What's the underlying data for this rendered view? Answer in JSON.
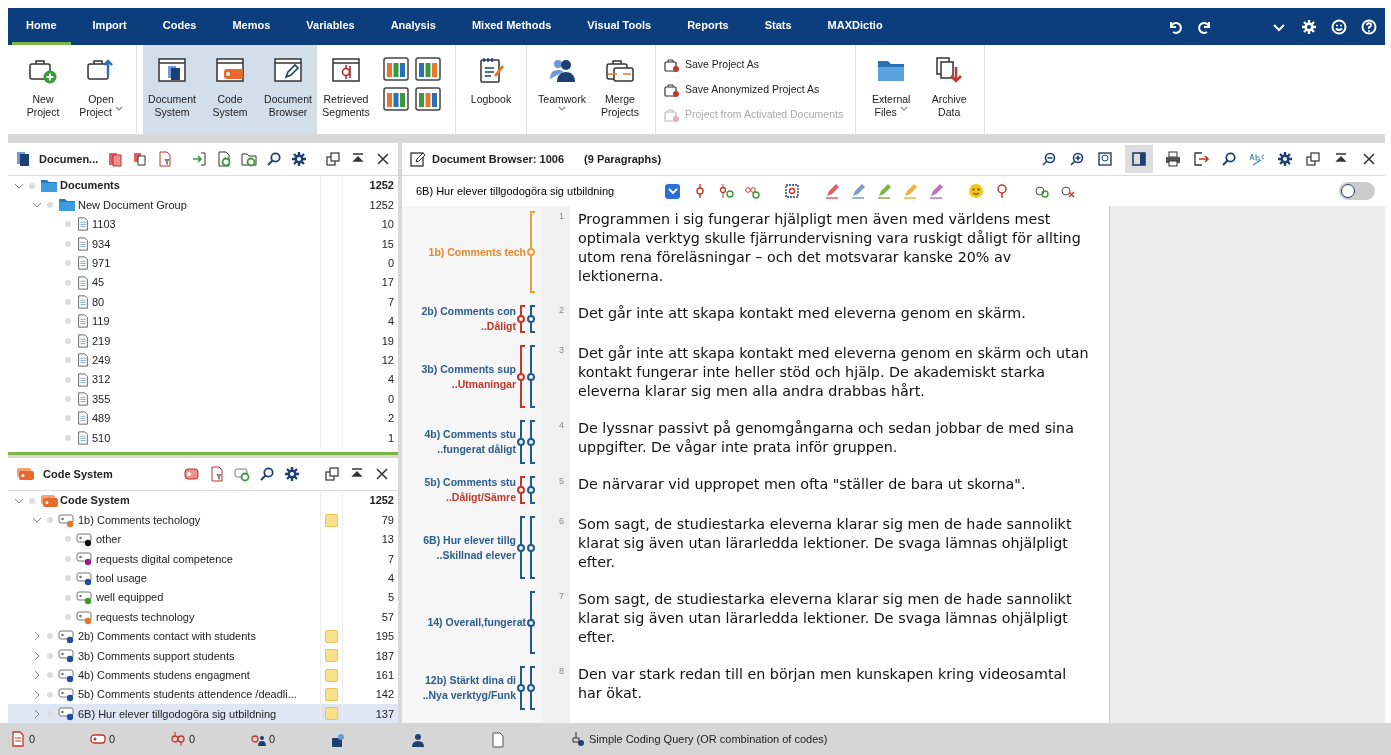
{
  "menu": {
    "tabs": [
      {
        "label": "Home",
        "selected": true
      },
      {
        "label": "Import",
        "selected": false
      },
      {
        "label": "Codes",
        "selected": false
      },
      {
        "label": "Memos",
        "selected": false
      },
      {
        "label": "Variables",
        "selected": false
      },
      {
        "label": "Analysis",
        "selected": false
      },
      {
        "label": "Mixed Methods",
        "selected": false
      },
      {
        "label": "Visual Tools",
        "selected": false
      },
      {
        "label": "Reports",
        "selected": false
      },
      {
        "label": "Stats",
        "selected": false
      },
      {
        "label": "MAXDictio",
        "selected": false
      }
    ]
  },
  "ribbon": {
    "groups": [
      {
        "buttons": [
          {
            "label": "New Project",
            "on": false,
            "dropdown": false
          },
          {
            "label": "Open Project",
            "on": false,
            "dropdown": true
          }
        ]
      },
      {
        "buttons": [
          {
            "label": "Document System",
            "on": true,
            "dropdown": false
          },
          {
            "label": "Code System",
            "on": true,
            "dropdown": false
          },
          {
            "label": "Document Browser",
            "on": true,
            "dropdown": false
          },
          {
            "label": "Retrieved Segments",
            "on": false,
            "dropdown": false
          }
        ]
      },
      {
        "buttons": [
          {
            "label": "Logbook",
            "on": false,
            "dropdown": false
          }
        ]
      },
      {
        "buttons": [
          {
            "label": "Teamwork",
            "on": false,
            "dropdown": true
          },
          {
            "label": "Merge Projects",
            "on": false,
            "dropdown": false
          }
        ]
      }
    ],
    "save_items": [
      {
        "label": "Save Project As",
        "disabled": false
      },
      {
        "label": "Save Anonymized Project As",
        "disabled": false
      },
      {
        "label": "Project from Activated Documents",
        "disabled": true
      }
    ],
    "file_buttons": [
      {
        "label": "External Files",
        "on": false,
        "dropdown": true
      },
      {
        "label": "Archive Data",
        "on": false,
        "dropdown": false
      }
    ]
  },
  "document_system": {
    "title": "Documen...",
    "tree": [
      {
        "label": "Documents",
        "count": "1252",
        "kind": "root",
        "expanded": true,
        "selected": false,
        "children": [
          {
            "label": "New Document Group",
            "count": "1252",
            "kind": "group",
            "expanded": true,
            "selected": false,
            "children": [
              {
                "label": "1103",
                "count": "10",
                "kind": "document",
                "selected": false
              },
              {
                "label": "934",
                "count": "15",
                "kind": "document",
                "selected": false
              },
              {
                "label": "971",
                "count": "0",
                "kind": "document",
                "selected": false
              },
              {
                "label": "45",
                "count": "17",
                "kind": "document",
                "selected": false
              },
              {
                "label": "80",
                "count": "7",
                "kind": "document",
                "selected": false
              },
              {
                "label": "119",
                "count": "4",
                "kind": "document",
                "selected": false
              },
              {
                "label": "219",
                "count": "19",
                "kind": "document",
                "selected": false
              },
              {
                "label": "249",
                "count": "12",
                "kind": "document",
                "selected": false
              },
              {
                "label": "312",
                "count": "4",
                "kind": "document",
                "selected": false
              },
              {
                "label": "355",
                "count": "0",
                "kind": "document",
                "selected": false
              },
              {
                "label": "489",
                "count": "2",
                "kind": "document",
                "selected": false
              },
              {
                "label": "510",
                "count": "1",
                "kind": "document",
                "selected": false
              }
            ]
          }
        ]
      }
    ]
  },
  "code_system": {
    "title": "Code System",
    "tree": [
      {
        "label": "Code System",
        "count": "1252",
        "kind": "root",
        "expanded": true,
        "selected": false,
        "children": [
          {
            "label": "1b) Comments  techology",
            "count": "79",
            "kind": "code",
            "color": "#e8772a",
            "memo": true,
            "expanded": true,
            "selected": false,
            "children": [
              {
                "label": "other",
                "count": "13",
                "kind": "code",
                "color": "#111111",
                "memo": false,
                "selected": false
              },
              {
                "label": "requests digital competence",
                "count": "7",
                "kind": "code",
                "color": "#9b1f8a",
                "memo": false,
                "selected": false
              },
              {
                "label": "tool usage",
                "count": "4",
                "kind": "code",
                "color": "#1f4f9a",
                "memo": false,
                "selected": false
              },
              {
                "label": "well equipped",
                "count": "5",
                "kind": "code",
                "color": "#3d9a2a",
                "memo": false,
                "selected": false
              },
              {
                "label": "requests technology",
                "count": "57",
                "kind": "code",
                "color": "#e8772a",
                "memo": false,
                "selected": false
              }
            ]
          },
          {
            "label": "2b) Comments contact with students",
            "count": "195",
            "kind": "code",
            "color": "#1f4f9a",
            "memo": true,
            "expanded": false,
            "selected": false
          },
          {
            "label": "3b) Comments support students",
            "count": "187",
            "kind": "code",
            "color": "#1f4f9a",
            "memo": true,
            "expanded": false,
            "selected": false
          },
          {
            "label": "4b) Comments studens engagment",
            "count": "161",
            "kind": "code",
            "color": "#1f4f9a",
            "memo": true,
            "expanded": false,
            "selected": false
          },
          {
            "label": "5b) Comments students attendence /deadli...",
            "count": "142",
            "kind": "code",
            "color": "#1f4f9a",
            "memo": true,
            "expanded": false,
            "selected": false
          },
          {
            "label": "6B) Hur elever tillgodogöra sig utbildning",
            "count": "137",
            "kind": "code",
            "color": "#1f4f9a",
            "memo": true,
            "expanded": false,
            "selected": true
          }
        ]
      }
    ]
  },
  "document_browser": {
    "title": "Document Browser: 1006",
    "subtitle": "(9 Paragraphs)",
    "code_field": "6B) Hur elever tillgodogöra sig utbildning",
    "paragraphs": [
      {
        "number": "1",
        "text": "Programmen i sig fungerar hjälpligt men även med världens mest optimala verktyg skulle fjärrundervisning vara ruskigt dåligt för allting utom rena föreläsningar – och det motsvarar kanske 20% av lektionerna.",
        "tags": [
          {
            "text": "1b) Comments  tech",
            "color": "#e08a2e"
          }
        ],
        "brackets": [
          {
            "color": "#e8a040"
          }
        ]
      },
      {
        "number": "2",
        "text": "Det går inte att skapa kontakt med eleverna genom en skärm.",
        "tags": [
          {
            "text": "2b) Comments con",
            "color": "#2b5d8f"
          },
          {
            "text": "..Dåligt",
            "color": "#c0392b"
          }
        ],
        "brackets": [
          {
            "color": "#c0392b"
          },
          {
            "color": "#1f5a8f"
          }
        ]
      },
      {
        "number": "3",
        "text": "Det går inte att skapa kontakt med eleverna genom en skärm och utan kontakt fungerar inte heller stöd och hjälp. De akademiskt starka eleverna klarar sig men alla andra drabbas hårt.",
        "tags": [
          {
            "text": "3b) Comments sup",
            "color": "#2b5d8f"
          },
          {
            "text": "..Utmaningar",
            "color": "#c0392b"
          }
        ],
        "brackets": [
          {
            "color": "#c0392b"
          },
          {
            "color": "#1f5a8f"
          }
        ]
      },
      {
        "number": "4",
        "text": "De lyssnar passivt på genomgångarna och sedan jobbar de med sina uppgifter. De vågar inte prata inför gruppen.",
        "tags": [
          {
            "text": "4b) Comments stu",
            "color": "#2b5d8f"
          },
          {
            "text": "..fungerat dåligt",
            "color": "#2b5d8f"
          }
        ],
        "brackets": [
          {
            "color": "#1f5a8f"
          },
          {
            "color": "#1f5a8f"
          }
        ]
      },
      {
        "number": "5",
        "text": "De närvarar vid uppropet men ofta \"ställer de bara ut skorna\".",
        "tags": [
          {
            "text": "5b) Comments stu",
            "color": "#2b5d8f"
          },
          {
            "text": "..Dåligt/Sämre",
            "color": "#c0392b"
          }
        ],
        "brackets": [
          {
            "color": "#c0392b"
          },
          {
            "color": "#1f5a8f"
          }
        ]
      },
      {
        "number": "6",
        "text": "Som sagt, de studiestarka eleverna klarar sig men de hade sannolikt klarat sig även utan lärarledda lektioner. De svaga lämnas ohjälpligt efter.",
        "tags": [
          {
            "text": "6B) Hur elever tillg",
            "color": "#2b5d8f"
          },
          {
            "text": "..Skillnad elever",
            "color": "#2b5d8f"
          }
        ],
        "brackets": [
          {
            "color": "#1f5a8f"
          },
          {
            "color": "#1f5a8f"
          }
        ]
      },
      {
        "number": "7",
        "text": "Som sagt, de studiestarka eleverna klarar sig men de hade sannolikt klarat sig även utan lärarledda lektioner. De svaga lämnas ohjälpligt efter.",
        "tags": [
          {
            "text": "14) Overall,fungerat",
            "color": "#2b5d8f"
          }
        ],
        "brackets": [
          {
            "color": "#1f5a8f"
          }
        ]
      },
      {
        "number": "8",
        "text": "Den var stark redan till en början men kunskapen kring videosamtal har ökat.",
        "tags": [
          {
            "text": "12b) Stärkt dina di",
            "color": "#2b5d8f"
          },
          {
            "text": "..Nya verktyg/Funk",
            "color": "#2b5d8f"
          }
        ],
        "brackets": [
          {
            "color": "#1f5a8f"
          },
          {
            "color": "#1f5a8f"
          }
        ]
      }
    ]
  },
  "edit_mode": {
    "on": false
  },
  "status_bar": {
    "counters": [
      "0",
      "0",
      "0",
      "0"
    ],
    "query": "Simple Coding Query (OR combination of codes)"
  }
}
